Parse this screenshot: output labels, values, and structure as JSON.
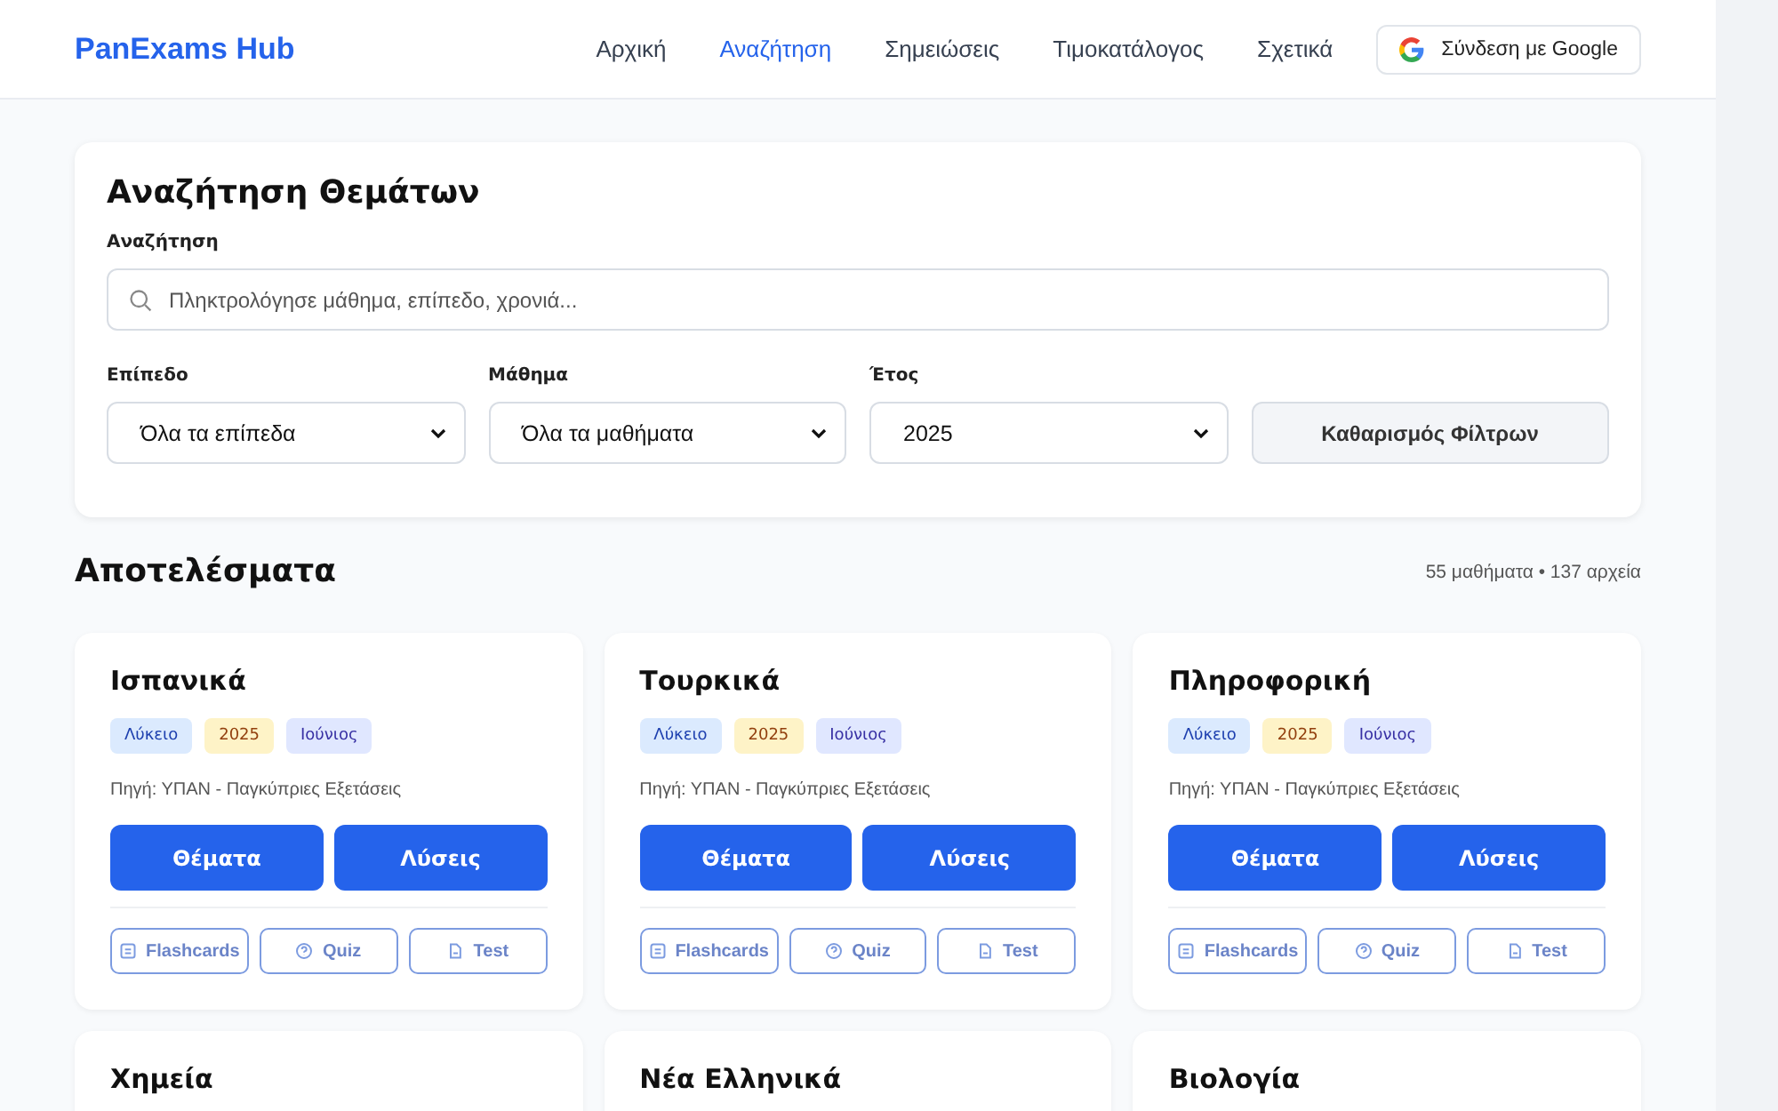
{
  "header": {
    "logo": "PanExams Hub",
    "nav": [
      {
        "label": "Αρχική",
        "selected": false
      },
      {
        "label": "Αναζήτηση",
        "selected": true
      },
      {
        "label": "Σημειώσεις",
        "selected": false
      },
      {
        "label": "Τιμοκατάλογος",
        "selected": false
      },
      {
        "label": "Σχετικά",
        "selected": false
      }
    ],
    "login_button": "Σύνδεση με Google"
  },
  "search_panel": {
    "title": "Αναζήτηση Θεμάτων",
    "search_label": "Αναζήτηση",
    "search_placeholder": "Πληκτρολόγησε μάθημα, επίπεδο, χρονιά...",
    "filters": [
      {
        "label": "Επίπεδο",
        "value": "Όλα τα επίπεδα"
      },
      {
        "label": "Μάθημα",
        "value": "Όλα τα μαθήματα"
      },
      {
        "label": "Έτος",
        "value": "2025"
      }
    ],
    "clear_button": "Καθαρισμός Φίλτρων"
  },
  "results": {
    "title": "Αποτελέσματα",
    "summary": "55 μαθήματα • 137 αρχεία",
    "cards": [
      {
        "title": "Ισπανικά",
        "tags": [
          {
            "kind": "level",
            "text": "Λύκειο"
          },
          {
            "kind": "year",
            "text": "2025"
          },
          {
            "kind": "month",
            "text": "Ιούνιος"
          }
        ],
        "source": "Πηγή: ΥΠΑΝ - Παγκύπριες Εξετάσεις",
        "primary_buttons": [
          "Θέματα",
          "Λύσεις"
        ],
        "tools": [
          {
            "kind": "flashcards",
            "label": "Flashcards"
          },
          {
            "kind": "quiz",
            "label": "Quiz"
          },
          {
            "kind": "test",
            "label": "Test"
          }
        ]
      },
      {
        "title": "Τουρκικά",
        "tags": [
          {
            "kind": "level",
            "text": "Λύκειο"
          },
          {
            "kind": "year",
            "text": "2025"
          },
          {
            "kind": "month",
            "text": "Ιούνιος"
          }
        ],
        "source": "Πηγή: ΥΠΑΝ - Παγκύπριες Εξετάσεις",
        "primary_buttons": [
          "Θέματα",
          "Λύσεις"
        ],
        "tools": [
          {
            "kind": "flashcards",
            "label": "Flashcards"
          },
          {
            "kind": "quiz",
            "label": "Quiz"
          },
          {
            "kind": "test",
            "label": "Test"
          }
        ]
      },
      {
        "title": "Πληροφορική",
        "tags": [
          {
            "kind": "level",
            "text": "Λύκειο"
          },
          {
            "kind": "year",
            "text": "2025"
          },
          {
            "kind": "month",
            "text": "Ιούνιος"
          }
        ],
        "source": "Πηγή: ΥΠΑΝ - Παγκύπριες Εξετάσεις",
        "primary_buttons": [
          "Θέματα",
          "Λύσεις"
        ],
        "tools": [
          {
            "kind": "flashcards",
            "label": "Flashcards"
          },
          {
            "kind": "quiz",
            "label": "Quiz"
          },
          {
            "kind": "test",
            "label": "Test"
          }
        ]
      },
      {
        "title": "Χημεία"
      },
      {
        "title": "Νέα Ελληνικά"
      },
      {
        "title": "Βιολογία"
      }
    ]
  }
}
